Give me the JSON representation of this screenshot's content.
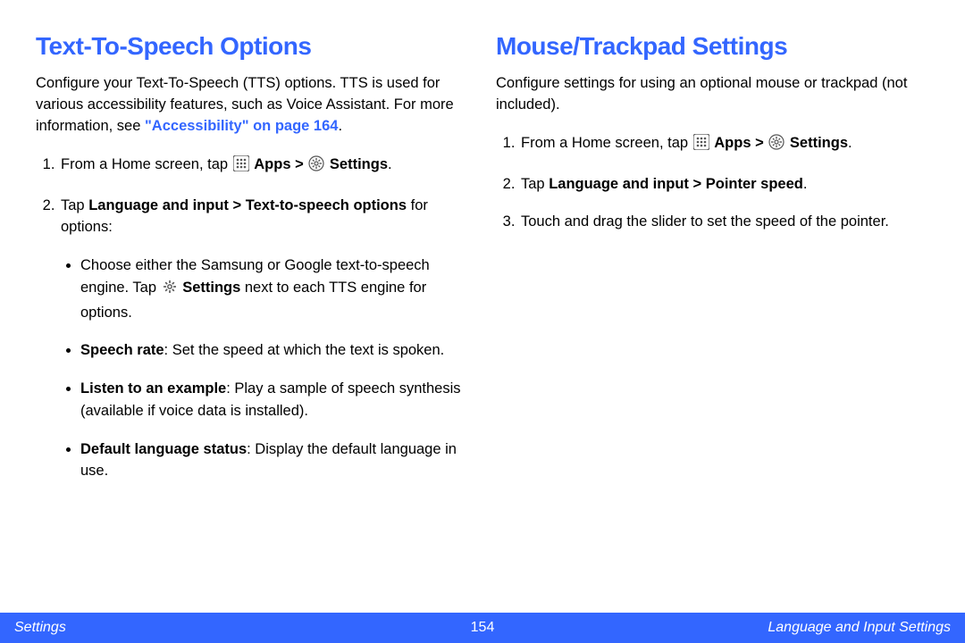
{
  "left": {
    "heading": "Text-To-Speech Options",
    "intro_1": "Configure your Text-To-Speech (TTS) options. TTS is used for various accessibility features, such as Voice Assistant. For more information, see ",
    "intro_link": "\"Accessibility\" on page 164",
    "intro_1_end": ".",
    "step1_pre": "From a Home screen, tap ",
    "step1_apps": "Apps > ",
    "step1_settings": "Settings",
    "step1_end": ".",
    "step2_pre": "Tap ",
    "step2_bold": "Language and input > Text-to-speech options",
    "step2_post": " for options:",
    "bullet1_pre": "Choose either the Samsung or Google text-to-speech engine. Tap ",
    "bullet1_settings": "Settings",
    "bullet1_post": " next to each TTS engine for options.",
    "bullet2_label": "Speech rate",
    "bullet2_text": ": Set the speed at which the text is spoken.",
    "bullet3_label": "Listen to an example",
    "bullet3_text": ": Play a sample of speech synthesis (available if voice data is installed).",
    "bullet4_label": "Default language status",
    "bullet4_text": ": Display the default language in use."
  },
  "right": {
    "heading": "Mouse/Trackpad Settings",
    "intro": "Configure settings for using an optional mouse or trackpad (not included).",
    "step1_pre": "From a Home screen, tap ",
    "step1_apps": "Apps > ",
    "step1_settings": "Settings",
    "step1_end": ".",
    "step2_pre": "Tap ",
    "step2_bold": "Language and input > Pointer speed",
    "step2_end": ".",
    "step3": "Touch and drag the slider to set the speed of the pointer."
  },
  "footer": {
    "left": "Settings",
    "center": "154",
    "right": "Language and Input Settings"
  }
}
